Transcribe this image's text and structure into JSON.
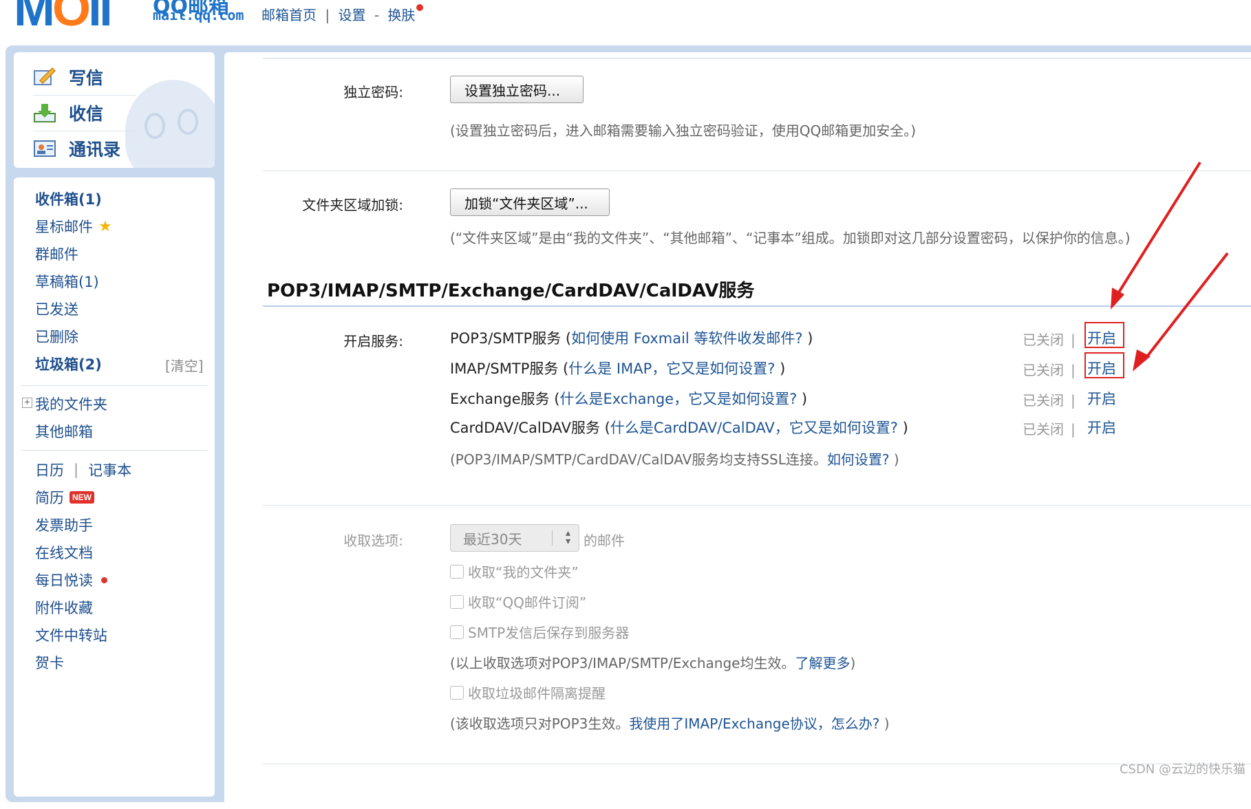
{
  "header": {
    "logo_text": "MOil",
    "logo_cn": "QQ邮箱",
    "logo_domain": "mail.qq.com",
    "nav": [
      "邮箱首页",
      "设置",
      "换肤"
    ],
    "nav_sep1": "|",
    "nav_sep2": "-"
  },
  "actions": [
    {
      "label": "写信",
      "icon": "compose-icon"
    },
    {
      "label": "收信",
      "icon": "inbox-download-icon"
    },
    {
      "label": "通讯录",
      "icon": "contacts-icon"
    }
  ],
  "sidebar": {
    "inbox": "收件箱(1)",
    "starred": "星标邮件",
    "group": "群邮件",
    "drafts": "草稿箱(1)",
    "sent": "已发送",
    "deleted": "已删除",
    "spam": "垃圾箱(2)",
    "spam_clear": "[清空]",
    "my_folders": "我的文件夹",
    "other_mailbox": "其他邮箱",
    "calendar": "日历",
    "sep": "|",
    "notes": "记事本",
    "resume": "简历",
    "new_badge": "NEW",
    "invoice": "发票助手",
    "online_docs": "在线文档",
    "daily_read": "每日悦读",
    "attachments": "附件收藏",
    "file_transfer": "文件中转站",
    "cards": "贺卡"
  },
  "settings": {
    "indep_pwd_label": "独立密码:",
    "indep_pwd_button": "设置独立密码...",
    "indep_pwd_hint": "(设置独立密码后，进入邮箱需要输入独立密码验证，使用QQ邮箱更加安全。)",
    "folder_lock_label": "文件夹区域加锁:",
    "folder_lock_button": "加锁“文件夹区域”...",
    "folder_lock_hint": "(“文件夹区域”是由“我的文件夹”、“其他邮箱”、“记事本”组成。加锁即对这几部分设置密码，以保护你的信息。)",
    "section_title": "POP3/IMAP/SMTP/Exchange/CardDAV/CalDAV服务",
    "enable_label": "开启服务:",
    "services": [
      {
        "name": "POP3/SMTP服务 (",
        "link": "如何使用 Foxmail 等软件收发邮件?",
        "tail": " )",
        "status": "已关闭",
        "sep": "|",
        "action": "开启"
      },
      {
        "name": "IMAP/SMTP服务 (",
        "link": "什么是 IMAP，它又是如何设置?",
        "tail": " )",
        "status": "已关闭",
        "sep": "|",
        "action": "开启"
      },
      {
        "name": "Exchange服务 (",
        "link": "什么是Exchange，它又是如何设置?",
        "tail": " )",
        "status": "已关闭",
        "sep": "|",
        "action": "开启"
      },
      {
        "name": "CardDAV/CalDAV服务 (",
        "link": "什么是CardDAV/CalDAV，它又是如何设置?",
        "tail": " )",
        "status": "已关闭",
        "sep": "|",
        "action": "开启"
      }
    ],
    "ssl_hint_pre": "(POP3/IMAP/SMTP/CardDAV/CalDAV服务均支持SSL连接。",
    "ssl_hint_link": "如何设置?",
    "ssl_hint_post": " )",
    "fetch_label": "收取选项:",
    "fetch_select": "最近30天",
    "fetch_suffix": "的邮件",
    "chk_my_folders": "收取“我的文件夹”",
    "chk_subscriptions": "收取“QQ邮件订阅”",
    "chk_smtp_save": "SMTP发信后保存到服务器",
    "fetch_hint_pre": "(以上收取选项对POP3/IMAP/SMTP/Exchange均生效。",
    "fetch_hint_link": "了解更多",
    "fetch_hint_post": ")",
    "chk_spam_alert": "收取垃圾邮件隔离提醒",
    "pop3_hint_pre": "(该收取选项只对POP3生效。",
    "pop3_hint_link": "我使用了IMAP/Exchange协议，怎么办?",
    "pop3_hint_post": " )"
  },
  "colors": {
    "accent": "#1e5494",
    "frame": "#c8d9ee",
    "highlight": "#e02020"
  },
  "watermark": "CSDN @云边的快乐猫"
}
